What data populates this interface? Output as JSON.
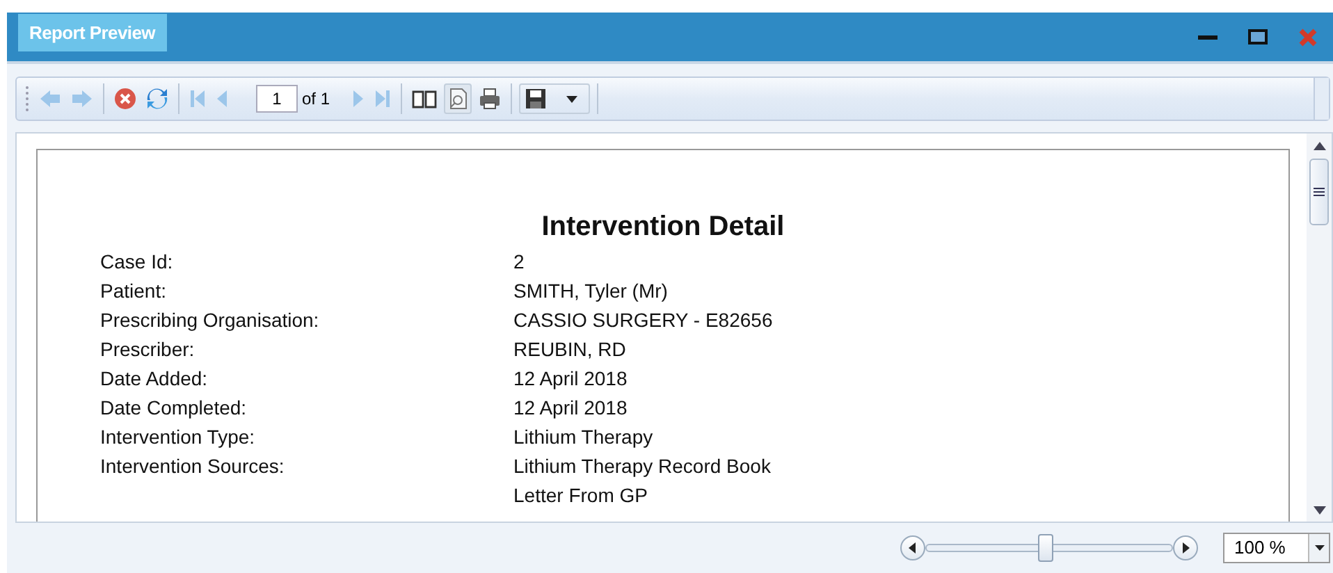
{
  "window": {
    "title": "Report Preview"
  },
  "toolbar": {
    "page": "1",
    "page_count": "of 1"
  },
  "report": {
    "title": "Intervention Detail",
    "fields": [
      {
        "label": "Case Id:",
        "values": [
          "2"
        ]
      },
      {
        "label": "Patient:",
        "values": [
          "SMITH, Tyler (Mr)"
        ]
      },
      {
        "label": "Prescribing Organisation:",
        "values": [
          "CASSIO SURGERY - E82656"
        ]
      },
      {
        "label": "Prescriber:",
        "values": [
          "REUBIN, RD"
        ]
      },
      {
        "label": "Date Added:",
        "values": [
          "12 April 2018"
        ]
      },
      {
        "label": "Date Completed:",
        "values": [
          "12 April 2018"
        ]
      },
      {
        "label": "Intervention Type:",
        "values": [
          "Lithium Therapy"
        ]
      },
      {
        "label": "Intervention Sources:",
        "values": [
          "Lithium Therapy Record Book",
          "Letter From GP"
        ]
      }
    ]
  },
  "zoom": {
    "level": 0.49,
    "value": "100 %"
  }
}
